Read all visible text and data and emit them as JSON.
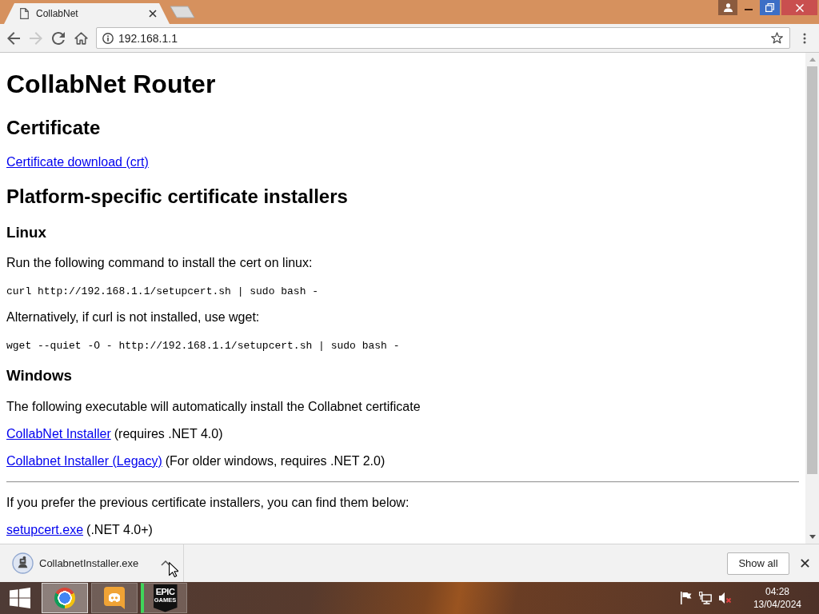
{
  "browser": {
    "tabs": [
      {
        "title": "CollabNet",
        "selected": true
      }
    ],
    "nav_buttons": [
      {
        "kind": "back",
        "disabled": false
      },
      {
        "kind": "forward",
        "disabled": true
      },
      {
        "kind": "reload",
        "disabled": false
      },
      {
        "kind": "home",
        "disabled": false
      }
    ],
    "address_bar": {
      "url": "192.168.1.1"
    }
  },
  "page": {
    "title": "CollabNet Router",
    "blocks": [
      {
        "kind": "heading",
        "text": "Certificate"
      },
      {
        "kind": "link_line",
        "link": "Certificate download (crt)"
      },
      {
        "kind": "heading",
        "text": "Platform-specific certificate installers"
      },
      {
        "kind": "subheading",
        "text": "Linux"
      },
      {
        "kind": "paragraph",
        "text": "Run the following command to install the cert on linux:"
      },
      {
        "kind": "command",
        "text": "curl http://192.168.1.1/setupcert.sh | sudo bash -"
      },
      {
        "kind": "paragraph",
        "text": "Alternatively, if curl is not installed, use wget:"
      },
      {
        "kind": "command",
        "text": "wget --quiet -O - http://192.168.1.1/setupcert.sh | sudo bash -"
      },
      {
        "kind": "subheading",
        "text": "Windows"
      },
      {
        "kind": "paragraph",
        "text": "The following executable will automatically install the Collabnet certificate"
      },
      {
        "kind": "link_line",
        "link": "CollabNet Installer",
        "note": "(requires .NET 4.0)"
      },
      {
        "kind": "link_line",
        "link": "Collabnet Installer (Legacy)",
        "note": "(For older windows, requires .NET 2.0)"
      },
      {
        "kind": "rule"
      },
      {
        "kind": "paragraph",
        "text": "If you prefer the previous certificate installers, you can find them below:"
      },
      {
        "kind": "link_line",
        "link": "setupcert.exe",
        "note": "(.NET 4.0+)"
      }
    ]
  },
  "downloads": {
    "items": [
      {
        "filename": "CollabnetInstaller.exe"
      }
    ],
    "show_all": "Show all"
  },
  "taskbar": {
    "apps": [
      {
        "kind": "browser",
        "selected": true,
        "attention": false
      },
      {
        "kind": "chat",
        "selected": false,
        "attention": false
      },
      {
        "kind": "games",
        "label": "EPIC",
        "sublabel": "GAMES",
        "selected": false,
        "attention": true
      }
    ],
    "sound_muted": true,
    "time": "04:28",
    "date": "13/04/2024"
  }
}
